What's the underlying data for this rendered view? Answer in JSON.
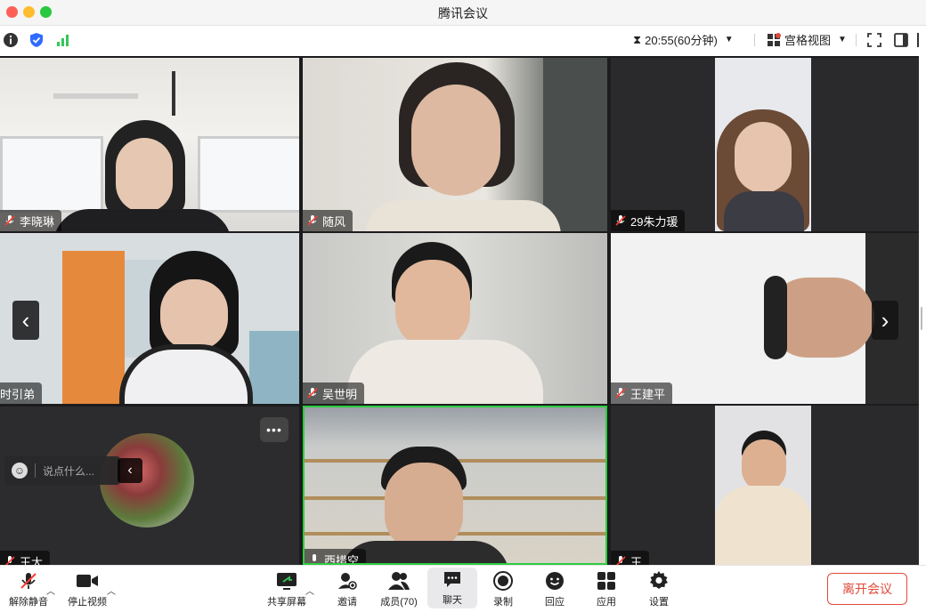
{
  "window": {
    "title": "腾讯会议"
  },
  "toolbar": {
    "timer": "20:55(60分钟)",
    "view_label": "宫格视图"
  },
  "participants": [
    {
      "name": "李晓琳"
    },
    {
      "name": "随风"
    },
    {
      "name": "29朱力瑗"
    },
    {
      "name": "时引弟"
    },
    {
      "name": "吴世明"
    },
    {
      "name": "王建平"
    },
    {
      "name": "王大"
    },
    {
      "name": "西措空"
    },
    {
      "name": "王"
    }
  ],
  "chat_input": {
    "placeholder": "说点什么..."
  },
  "bottom": {
    "unmute": "解除静音",
    "stop_video": "停止视频",
    "share": "共享屏幕",
    "invite": "邀请",
    "members": "成员(70)",
    "chat": "聊天",
    "record": "录制",
    "reaction": "回应",
    "apps": "应用",
    "settings": "设置",
    "leave": "离开会议"
  },
  "colors": {
    "accent_blue": "#2f6bff",
    "leave_red": "#e04a3a",
    "active_speaker": "#2ecc40",
    "signal_green": "#34c759"
  }
}
